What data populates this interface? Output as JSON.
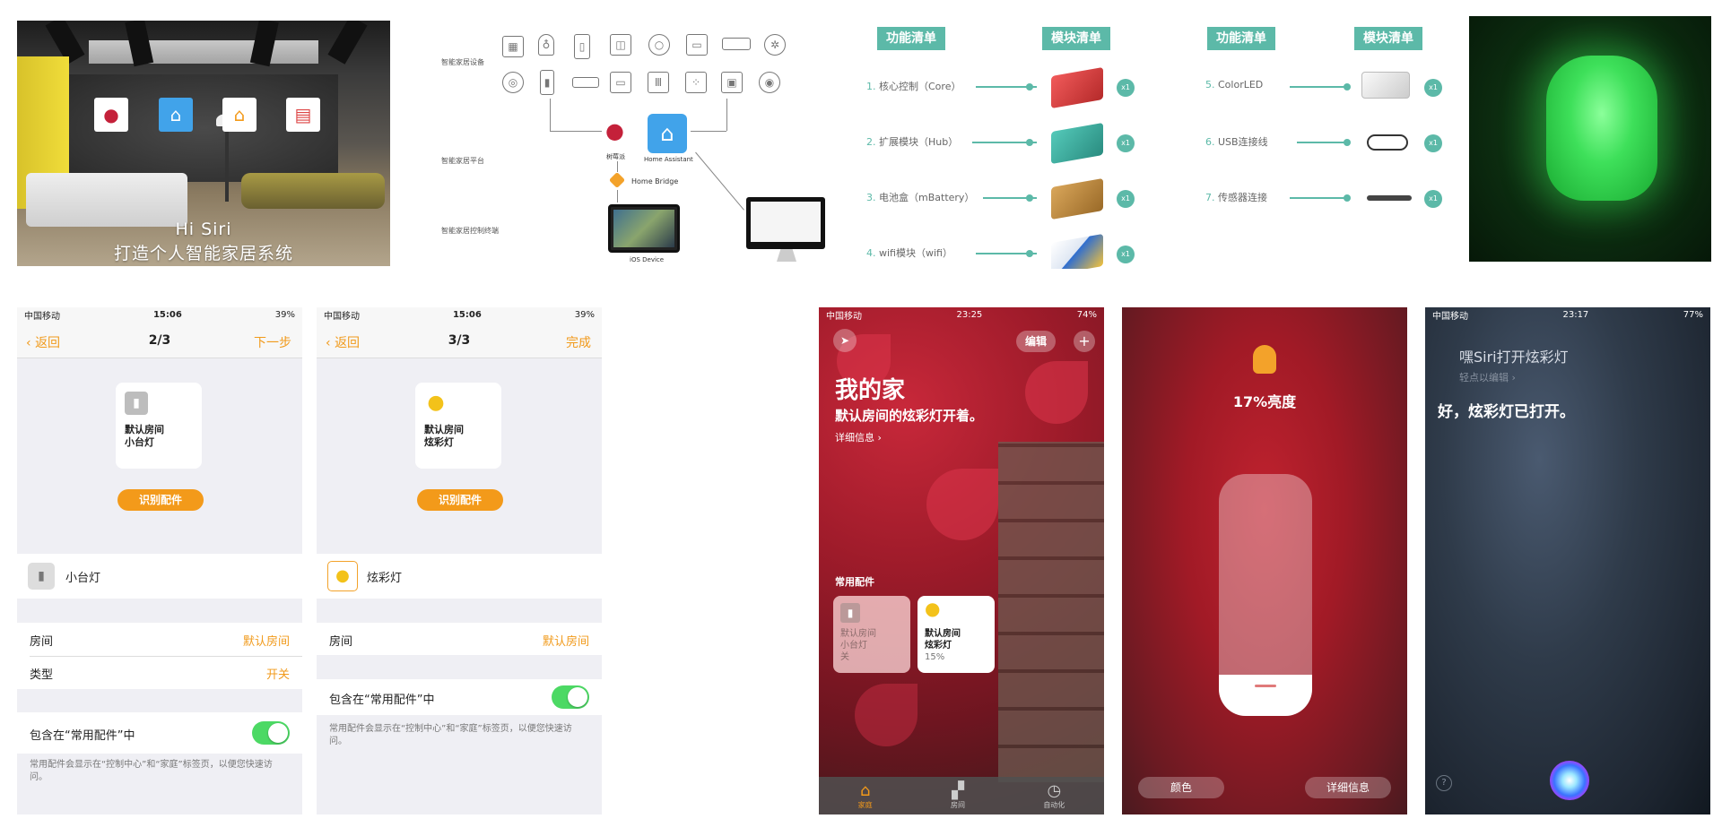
{
  "banner": {
    "line1": "Hi Siri",
    "line2": "打造个人智能家居系统",
    "icons": [
      "raspberry-icon",
      "home-assistant-icon",
      "homekit-icon",
      "books-icon"
    ]
  },
  "architecture": {
    "row_labels": [
      "智能家居设备",
      "智能家居平台",
      "智能家居控制终端"
    ],
    "rpi_caption": "树莓派",
    "ha_caption": "Home Assistant",
    "bridge_caption": "Home Bridge",
    "ios_caption": "iOS Device"
  },
  "modules_left": {
    "header_func": "功能清单",
    "header_mod": "模块清单",
    "items": [
      {
        "num": "1.",
        "text": "核心控制（Core）",
        "qty": "x1",
        "color": "#d63a3a"
      },
      {
        "num": "2.",
        "text": "扩展模块（Hub）",
        "qty": "x1",
        "color": "#3aa79b"
      },
      {
        "num": "3.",
        "text": "电池盒（mBattery）",
        "qty": "x1",
        "color": "#c08a3c"
      },
      {
        "num": "4.",
        "text": "wifi模块（wifi）",
        "qty": "x1",
        "color": "#3a7fd6"
      }
    ]
  },
  "modules_right": {
    "header_func": "功能清单",
    "header_mod": "模块清单",
    "items": [
      {
        "num": "5.",
        "text": "ColorLED",
        "qty": "x1"
      },
      {
        "num": "6.",
        "text": "USB连接线",
        "qty": "x1"
      },
      {
        "num": "7.",
        "text": "传感器连接",
        "qty": "x1"
      }
    ]
  },
  "phone1": {
    "status": {
      "carrier": "中国移动",
      "time": "15:06",
      "battery": "39%"
    },
    "nav": {
      "back": "返回",
      "title": "2/3",
      "next": "下一步"
    },
    "tile": {
      "room": "默认房间",
      "name": "小台灯"
    },
    "identify": "识别配件",
    "accessory_name": "小台灯",
    "room_label": "房间",
    "room_value": "默认房间",
    "type_label": "类型",
    "type_value": "开关",
    "include_label": "包含在“常用配件”中",
    "note": "常用配件会显示在“控制中心”和“家庭”标签页，以便您快速访问。"
  },
  "phone2": {
    "status": {
      "carrier": "中国移动",
      "time": "15:06",
      "battery": "39%"
    },
    "nav": {
      "back": "返回",
      "title": "3/3",
      "next": "完成"
    },
    "tile": {
      "room": "默认房间",
      "name": "炫彩灯"
    },
    "identify": "识别配件",
    "accessory_name": "炫彩灯",
    "room_label": "房间",
    "room_value": "默认房间",
    "include_label": "包含在“常用配件”中",
    "note": "常用配件会显示在“控制中心”和“家庭”标签页，以便您快速访问。"
  },
  "home": {
    "status": {
      "carrier": "中国移动",
      "time": "23:25",
      "battery": "74%"
    },
    "edit": "编辑",
    "title": "我的家",
    "subtitle": "默认房间的炫彩灯开着。",
    "details": "详细信息 ›",
    "section": "常用配件",
    "tile1": {
      "room": "默认房间",
      "name": "小台灯",
      "state": "关"
    },
    "tile2": {
      "room": "默认房间",
      "name": "炫彩灯",
      "state": "15%"
    },
    "tabs": [
      "家庭",
      "房间",
      "自动化"
    ]
  },
  "brightness": {
    "label": "17%亮度",
    "level": 0.17,
    "color_btn": "颜色",
    "details_btn": "详细信息"
  },
  "siri": {
    "status": {
      "carrier": "中国移动",
      "time": "23:17",
      "battery": "77%"
    },
    "query": "嘿Siri打开炫彩灯",
    "edit_hint": "轻点以编辑 ›",
    "response": "好，炫彩灯已打开。",
    "help": "?"
  }
}
